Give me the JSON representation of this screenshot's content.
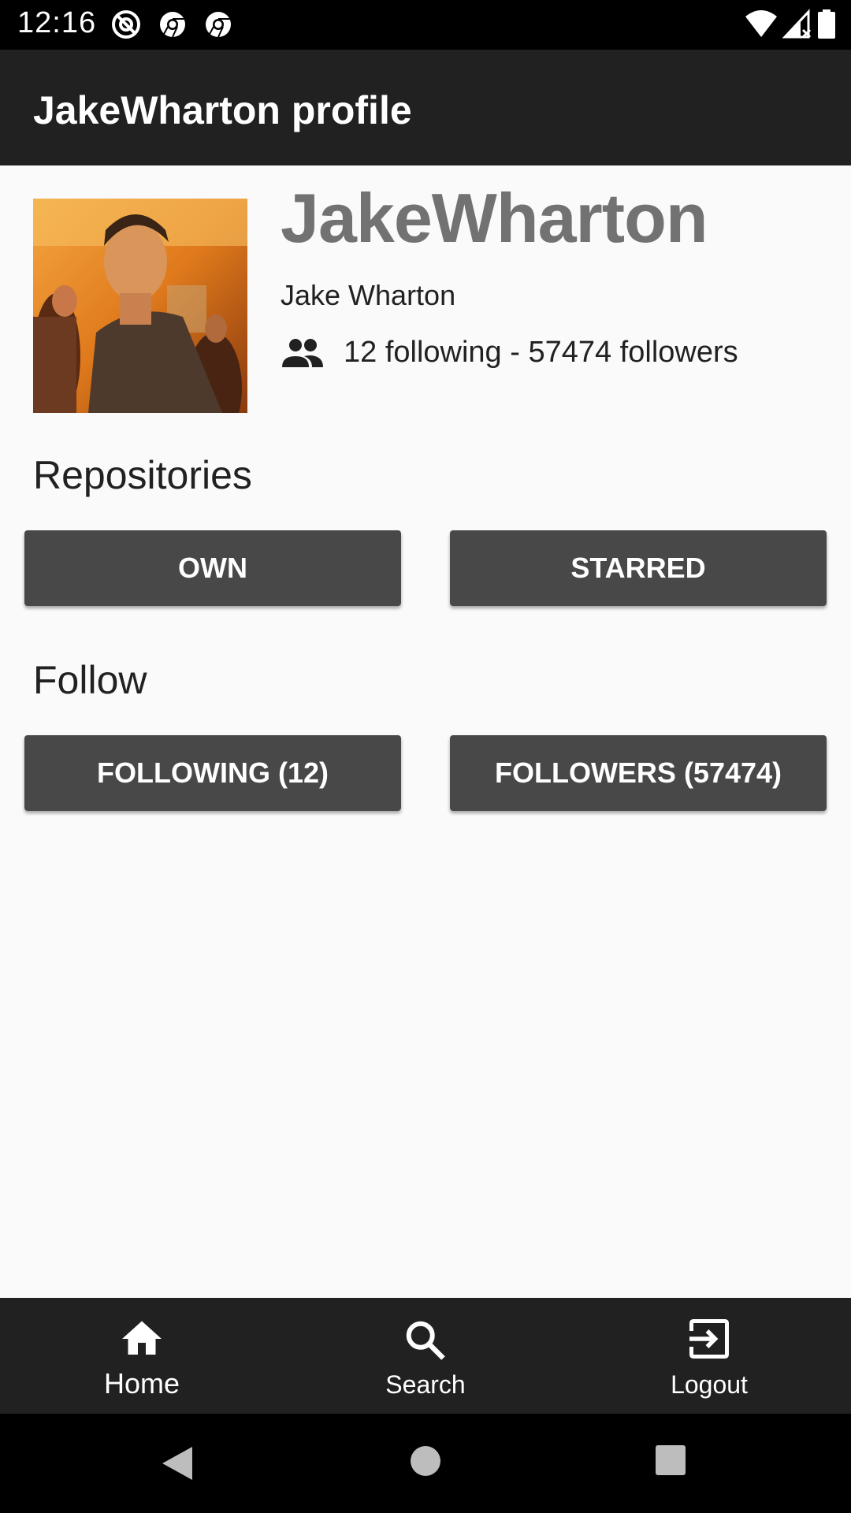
{
  "status_bar": {
    "time": "12:16",
    "icons": [
      "at-sign-icon",
      "chrome-icon",
      "chrome-icon",
      "wifi-icon",
      "signal-icon",
      "battery-icon"
    ]
  },
  "app_bar": {
    "title": "JakeWharton profile"
  },
  "profile": {
    "avatar_icon": "profile-photo",
    "username": "JakeWharton",
    "full_name": "Jake Wharton",
    "follow_stats": "12 following - 57474 followers"
  },
  "repositories": {
    "title": "Repositories",
    "own_label": "OWN",
    "starred_label": "STARRED"
  },
  "follow": {
    "title": "Follow",
    "following_label": "FOLLOWING (12)",
    "followers_label": "FOLLOWERS (57474)"
  },
  "bottom_nav": {
    "items": [
      {
        "label": "Home",
        "icon": "home-icon",
        "active": true
      },
      {
        "label": "Search",
        "icon": "search-icon",
        "active": false
      },
      {
        "label": "Logout",
        "icon": "logout-icon",
        "active": false
      }
    ]
  },
  "colors": {
    "app_bar": "#212121",
    "button": "#484848",
    "username": "#727272",
    "background": "#fafafa"
  }
}
